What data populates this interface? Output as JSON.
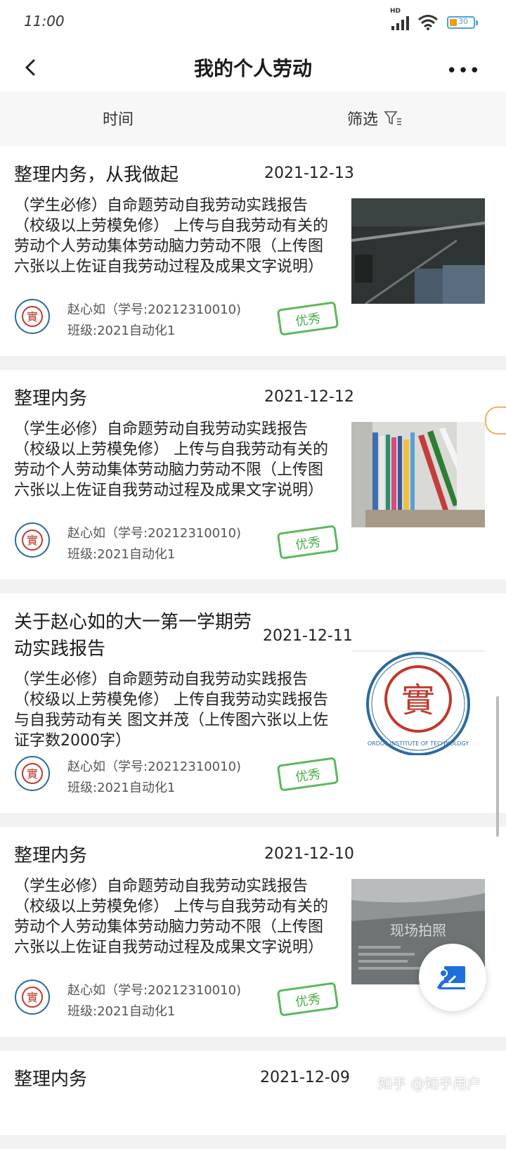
{
  "status": {
    "time": "11:00",
    "network": "HD",
    "battery": "30"
  },
  "header": {
    "title": "我的个人劳动"
  },
  "filter": {
    "time_tab": "时间",
    "filter_tab": "筛选"
  },
  "items": [
    {
      "title": "整理内务，从我做起",
      "date": "2021-12-13",
      "desc": "（学生必修）自命题劳动自我劳动实践报告（校级以上劳模免修） 上传与自我劳动有关的劳动个人劳动集体劳动脑力劳动不限（上传图六张以上佐证自我劳动过程及成果文字说明）",
      "student": "赵心如（学号:20212310010)",
      "class": "班级:2021自动化1",
      "badge": "优秀",
      "thumb": "closet-photo"
    },
    {
      "title": "整理内务",
      "date": "2021-12-12",
      "desc": "（学生必修）自命题劳动自我劳动实践报告（校级以上劳模免修） 上传与自我劳动有关的劳动个人劳动集体劳动脑力劳动不限（上传图六张以上佐证自我劳动过程及成果文字说明）",
      "student": "赵心如（学号:20212310010)",
      "class": "班级:2021自动化1",
      "badge": "优秀",
      "thumb": "bookshelf-photo"
    },
    {
      "title": "关于赵心如的大一第一学期劳动实践报告",
      "date": "2021-12-11",
      "desc": "（学生必修）自命题劳动自我劳动实践报告（校级以上劳模免修） 上传自我劳动实践报告与自我劳动有关 图文并茂（上传图六张以上佐证字数2000字）",
      "student": "赵心如（学号:20212310010)",
      "class": "班级:2021自动化1",
      "badge": "优秀",
      "thumb": "school-logo",
      "logo_text": "ORDOS INSTITUTE OF TECHNOLOGY"
    },
    {
      "title": "整理内务",
      "date": "2021-12-10",
      "desc": "（学生必修）自命题劳动自我劳动实践报告（校级以上劳模免修） 上传与自我劳动有关的劳动个人劳动集体劳动脑力劳动不限（上传图六张以上佐证自我劳动过程及成果文字说明）",
      "student": "赵心如（学号:20212310010)",
      "class": "班级:2021自动化1",
      "badge": "优秀",
      "thumb": "box-photo",
      "thumb_text": "现场拍照"
    },
    {
      "title": "整理内务",
      "date": "2021-12-09"
    }
  ],
  "watermark": "知乎 @知乎用户",
  "colors": {
    "badge": "#5cb85c",
    "logo_red": "#c0392b",
    "logo_blue": "#2c6aa0"
  }
}
